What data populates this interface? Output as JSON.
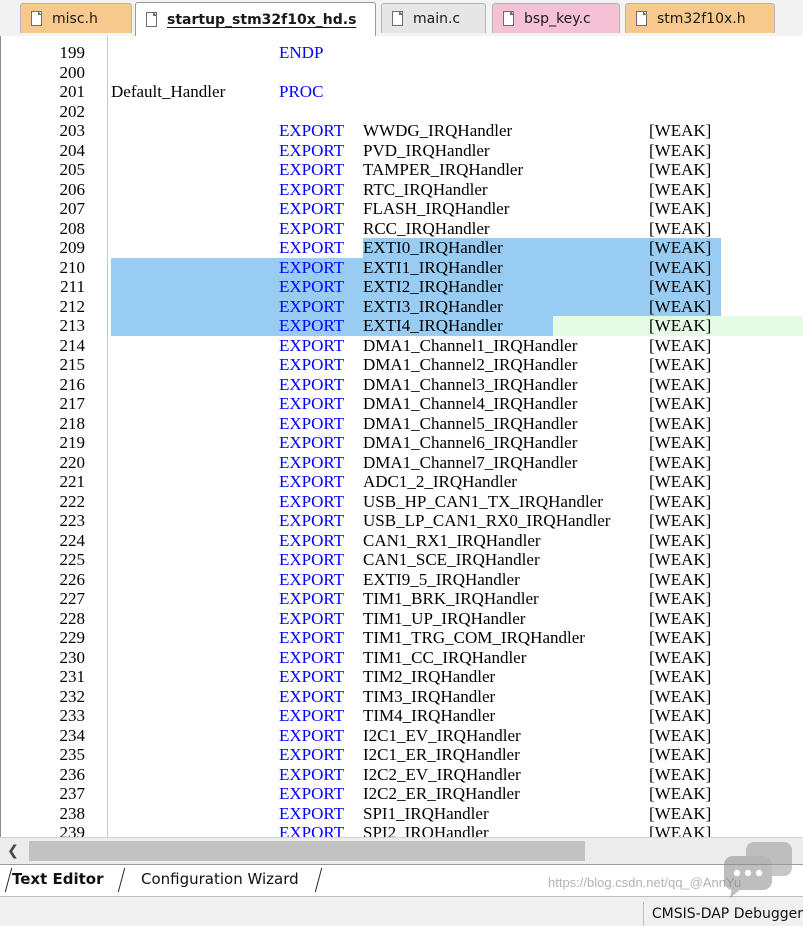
{
  "tabs": [
    {
      "label": "misc.h",
      "active": false,
      "color": "#f7c98c"
    },
    {
      "label": "startup_stm32f10x_hd.s",
      "active": true,
      "color": "#ffffff"
    },
    {
      "label": "main.c",
      "active": false,
      "color": "#e6e6e6"
    },
    {
      "label": "bsp_key.c",
      "active": false,
      "color": "#f5c1d4"
    },
    {
      "label": "stm32f10x.h",
      "active": false,
      "color": "#f7c98c"
    }
  ],
  "code_lines": [
    {
      "num": "199",
      "label": "",
      "kw": "ENDP",
      "sym": "",
      "attr": ""
    },
    {
      "num": "200",
      "label": "",
      "kw": "",
      "sym": "",
      "attr": ""
    },
    {
      "num": "201",
      "label": "Default_Handler",
      "kw": "PROC",
      "sym": "",
      "attr": ""
    },
    {
      "num": "202",
      "label": "",
      "kw": "",
      "sym": "",
      "attr": ""
    },
    {
      "num": "203",
      "label": "",
      "kw": "EXPORT",
      "sym": "WWDG_IRQHandler",
      "attr": "[WEAK]"
    },
    {
      "num": "204",
      "label": "",
      "kw": "EXPORT",
      "sym": "PVD_IRQHandler",
      "attr": "[WEAK]"
    },
    {
      "num": "205",
      "label": "",
      "kw": "EXPORT",
      "sym": "TAMPER_IRQHandler",
      "attr": "[WEAK]"
    },
    {
      "num": "206",
      "label": "",
      "kw": "EXPORT",
      "sym": "RTC_IRQHandler",
      "attr": "[WEAK]"
    },
    {
      "num": "207",
      "label": "",
      "kw": "EXPORT",
      "sym": "FLASH_IRQHandler",
      "attr": "[WEAK]"
    },
    {
      "num": "208",
      "label": "",
      "kw": "EXPORT",
      "sym": "RCC_IRQHandler",
      "attr": "[WEAK]"
    },
    {
      "num": "209",
      "label": "",
      "kw": "EXPORT",
      "sym": "EXTI0_IRQHandler",
      "attr": "[WEAK]"
    },
    {
      "num": "210",
      "label": "",
      "kw": "EXPORT",
      "sym": "EXTI1_IRQHandler",
      "attr": "[WEAK]"
    },
    {
      "num": "211",
      "label": "",
      "kw": "EXPORT",
      "sym": "EXTI2_IRQHandler",
      "attr": "[WEAK]"
    },
    {
      "num": "212",
      "label": "",
      "kw": "EXPORT",
      "sym": "EXTI3_IRQHandler",
      "attr": "[WEAK]"
    },
    {
      "num": "213",
      "label": "",
      "kw": "EXPORT",
      "sym": "EXTI4_IRQHandler",
      "attr": "[WEAK]"
    },
    {
      "num": "214",
      "label": "",
      "kw": "EXPORT",
      "sym": "DMA1_Channel1_IRQHandler",
      "attr": "[WEAK]"
    },
    {
      "num": "215",
      "label": "",
      "kw": "EXPORT",
      "sym": "DMA1_Channel2_IRQHandler",
      "attr": "[WEAK]"
    },
    {
      "num": "216",
      "label": "",
      "kw": "EXPORT",
      "sym": "DMA1_Channel3_IRQHandler",
      "attr": "[WEAK]"
    },
    {
      "num": "217",
      "label": "",
      "kw": "EXPORT",
      "sym": "DMA1_Channel4_IRQHandler",
      "attr": "[WEAK]"
    },
    {
      "num": "218",
      "label": "",
      "kw": "EXPORT",
      "sym": "DMA1_Channel5_IRQHandler",
      "attr": "[WEAK]"
    },
    {
      "num": "219",
      "label": "",
      "kw": "EXPORT",
      "sym": "DMA1_Channel6_IRQHandler",
      "attr": "[WEAK]"
    },
    {
      "num": "220",
      "label": "",
      "kw": "EXPORT",
      "sym": "DMA1_Channel7_IRQHandler",
      "attr": "[WEAK]"
    },
    {
      "num": "221",
      "label": "",
      "kw": "EXPORT",
      "sym": "ADC1_2_IRQHandler",
      "attr": "[WEAK]"
    },
    {
      "num": "222",
      "label": "",
      "kw": "EXPORT",
      "sym": "USB_HP_CAN1_TX_IRQHandler",
      "attr": "[WEAK]"
    },
    {
      "num": "223",
      "label": "",
      "kw": "EXPORT",
      "sym": "USB_LP_CAN1_RX0_IRQHandler",
      "attr": "[WEAK]"
    },
    {
      "num": "224",
      "label": "",
      "kw": "EXPORT",
      "sym": "CAN1_RX1_IRQHandler",
      "attr": "[WEAK]"
    },
    {
      "num": "225",
      "label": "",
      "kw": "EXPORT",
      "sym": "CAN1_SCE_IRQHandler",
      "attr": "[WEAK]"
    },
    {
      "num": "226",
      "label": "",
      "kw": "EXPORT",
      "sym": "EXTI9_5_IRQHandler",
      "attr": "[WEAK]"
    },
    {
      "num": "227",
      "label": "",
      "kw": "EXPORT",
      "sym": "TIM1_BRK_IRQHandler",
      "attr": "[WEAK]"
    },
    {
      "num": "228",
      "label": "",
      "kw": "EXPORT",
      "sym": "TIM1_UP_IRQHandler",
      "attr": "[WEAK]"
    },
    {
      "num": "229",
      "label": "",
      "kw": "EXPORT",
      "sym": "TIM1_TRG_COM_IRQHandler",
      "attr": "[WEAK]"
    },
    {
      "num": "230",
      "label": "",
      "kw": "EXPORT",
      "sym": "TIM1_CC_IRQHandler",
      "attr": "[WEAK]"
    },
    {
      "num": "231",
      "label": "",
      "kw": "EXPORT",
      "sym": "TIM2_IRQHandler",
      "attr": "[WEAK]"
    },
    {
      "num": "232",
      "label": "",
      "kw": "EXPORT",
      "sym": "TIM3_IRQHandler",
      "attr": "[WEAK]"
    },
    {
      "num": "233",
      "label": "",
      "kw": "EXPORT",
      "sym": "TIM4_IRQHandler",
      "attr": "[WEAK]"
    },
    {
      "num": "234",
      "label": "",
      "kw": "EXPORT",
      "sym": "I2C1_EV_IRQHandler",
      "attr": "[WEAK]"
    },
    {
      "num": "235",
      "label": "",
      "kw": "EXPORT",
      "sym": "I2C1_ER_IRQHandler",
      "attr": "[WEAK]"
    },
    {
      "num": "236",
      "label": "",
      "kw": "EXPORT",
      "sym": "I2C2_EV_IRQHandler",
      "attr": "[WEAK]"
    },
    {
      "num": "237",
      "label": "",
      "kw": "EXPORT",
      "sym": "I2C2_ER_IRQHandler",
      "attr": "[WEAK]"
    },
    {
      "num": "238",
      "label": "",
      "kw": "EXPORT",
      "sym": "SPI1_IRQHandler",
      "attr": "[WEAK]"
    },
    {
      "num": "239",
      "label": "",
      "kw": "EXPORT",
      "sym": "SPI2_IRQHandler",
      "attr": "[WEAK]"
    }
  ],
  "selection": {
    "start_line": "209",
    "end_line": "213",
    "color": "#99ccf2"
  },
  "current_line": {
    "line": "213",
    "color": "#e6fbe6"
  },
  "keyword_color": "#0000ff",
  "scrollbar": {
    "left_arrow_icon": "chevron-left-icon"
  },
  "bottom_tabs": {
    "text_editor": "Text Editor",
    "config_wizard": "Configuration Wizard"
  },
  "status": {
    "debugger": "CMSIS-DAP Debugger",
    "watermark": "https://blog.csdn.net/qq_@AnnYu"
  }
}
